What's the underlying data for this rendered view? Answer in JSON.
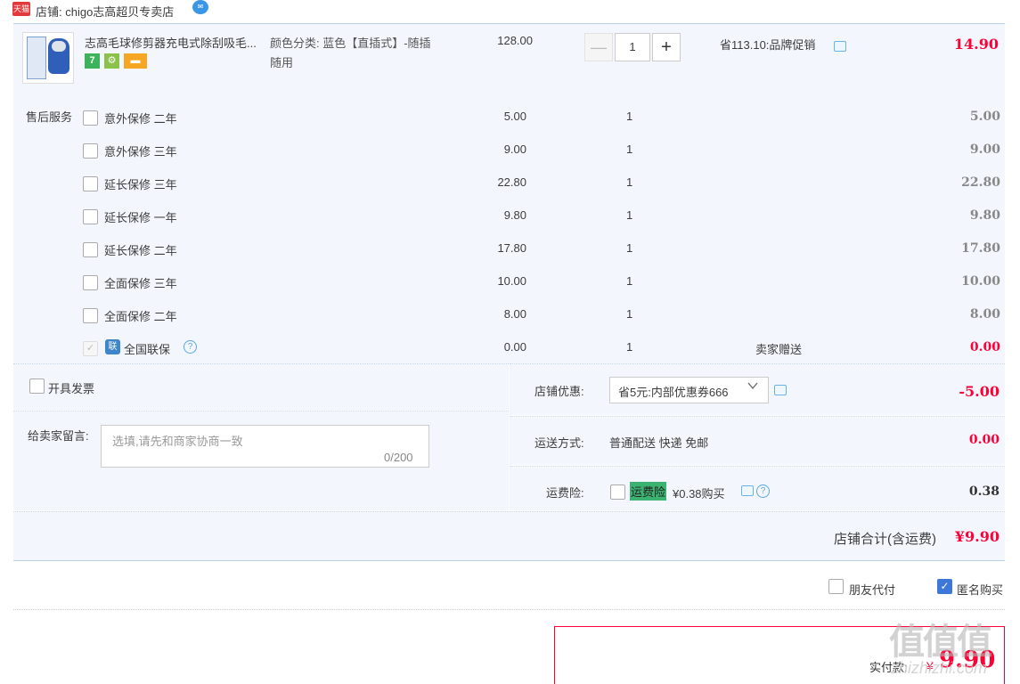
{
  "shop": {
    "badge": "天猫",
    "label": "店铺:  chigo志高超贝专卖店"
  },
  "product": {
    "title": "志高毛球修剪器充电式除刮吸毛...",
    "badges": {
      "b7": "7",
      "bg": "⚙",
      "bc": "▬"
    },
    "sku_line1": "颜色分类:  蓝色【直插式】-随插",
    "sku_line2": "随用",
    "price": "128.00",
    "qty": "1",
    "minus": "—",
    "plus": "+",
    "promo": "省113.10:品牌促销",
    "subtotal": "14.90"
  },
  "services": {
    "label": "售后服务",
    "items": [
      {
        "name": "意外保修  二年",
        "price": "5.00",
        "qty": "1",
        "total": "5.00"
      },
      {
        "name": "意外保修  三年",
        "price": "9.00",
        "qty": "1",
        "total": "9.00"
      },
      {
        "name": "延长保修  三年",
        "price": "22.80",
        "qty": "1",
        "total": "22.80"
      },
      {
        "name": "延长保修  一年",
        "price": "9.80",
        "qty": "1",
        "total": "9.80"
      },
      {
        "name": "延长保修  二年",
        "price": "17.80",
        "qty": "1",
        "total": "17.80"
      },
      {
        "name": "全面保修  三年",
        "price": "10.00",
        "qty": "1",
        "total": "10.00"
      },
      {
        "name": "全面保修  二年",
        "price": "8.00",
        "qty": "1",
        "total": "8.00"
      }
    ],
    "guarantee": {
      "icon": "联",
      "name": "全国联保",
      "price": "0.00",
      "qty": "1",
      "gift": "卖家赠送",
      "total": "0.00"
    }
  },
  "invoice": {
    "label": "开具发票"
  },
  "message": {
    "label": "给卖家留言:",
    "placeholder": "选填,请先和商家协商一致",
    "count": "0/200"
  },
  "discount": {
    "label": "店铺优惠:",
    "selected": "省5元:内部优惠券666",
    "amount": "-5.00"
  },
  "shipping": {
    "label": "运送方式:",
    "value": "普通配送 快递 免邮",
    "amount": "0.00"
  },
  "insurance": {
    "label": "运费险:",
    "tag": "运费险",
    "price": "¥0.38购买",
    "amount": "0.38"
  },
  "total": {
    "label": "店铺合计(含运费)",
    "amount": "¥9.90"
  },
  "options": {
    "friend_pay": "朋友代付",
    "anonymous": "匿名购买"
  },
  "payment": {
    "label": "实付款:",
    "currency": "¥",
    "amount": "9.90"
  },
  "watermark": {
    "logo": "值值值",
    "text": "zhizhizhi.com"
  },
  "colors": {
    "accent_red": "#ff0036",
    "panel_bg": "#f3f7fd",
    "check_blue": "#3d78d8",
    "tag_green": "#3cb371"
  }
}
